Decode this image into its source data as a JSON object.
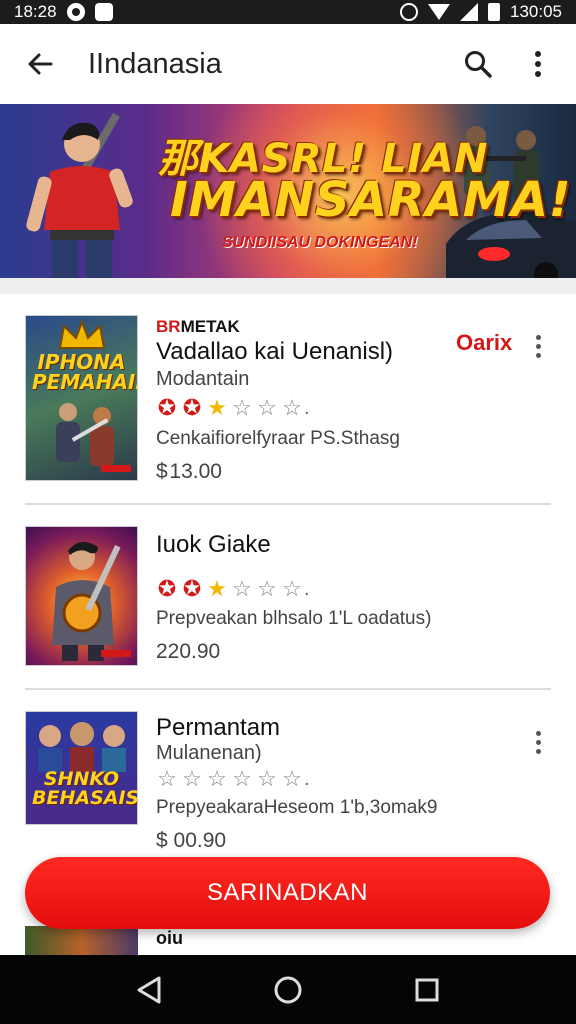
{
  "status_bar": {
    "time": "18:28",
    "clock_right": "130:05",
    "icons_left": [
      "record-icon",
      "notification-icon"
    ],
    "icons_right": [
      "alarm-icon",
      "wifi-icon",
      "signal-icon",
      "battery-icon"
    ]
  },
  "app_bar": {
    "title": "IIndanasia",
    "icons": [
      "back-arrow-icon",
      "search-icon",
      "more-vert-icon"
    ]
  },
  "banner": {
    "headline_line1": "那KASRL! LIAN",
    "headline_line2": "IMANSARAMA!",
    "subline": "SUNDIISAU DOKINGEAN!"
  },
  "items": [
    {
      "label_red": "BR",
      "label_rest": "METAK",
      "title": "Vadallao kai Uenanisl)",
      "subtitle": "Modantain",
      "rating": {
        "filled_red": 2,
        "half_gold": 1,
        "empty": 3
      },
      "description": "Cenkaifiorelfyraar PS.Sthasg",
      "price": "$ 13.00",
      "badge": "Oarix",
      "thumb_text": "IPHONA PEMAHAII!"
    },
    {
      "title": "Iuok Giake",
      "rating": {
        "filled_red": 2,
        "half_gold": 1,
        "empty": 3
      },
      "description": "Prepveakan blhsalo 1'L oadatus)",
      "price": "220.90",
      "thumb_text": ""
    },
    {
      "title": "Permantam",
      "subtitle": "Mulanenan)",
      "rating": {
        "filled_red": 0,
        "half_gold": 0,
        "empty": 6
      },
      "description": "PrepyeakaraHeseom 1'b,3omak9",
      "price": "$ 00.90",
      "thumb_text": "SHNKO BEHASAIS"
    }
  ],
  "peek_item": {
    "title": "oiu"
  },
  "cta": {
    "label": "SARINADKAN"
  },
  "nav_bar": {
    "icons": [
      "back-triangle-icon",
      "home-circle-icon",
      "recents-square-icon"
    ]
  },
  "colors": {
    "accent": "#e40d0d",
    "star_gold": "#f2b800",
    "nav_bg": "#050505"
  }
}
